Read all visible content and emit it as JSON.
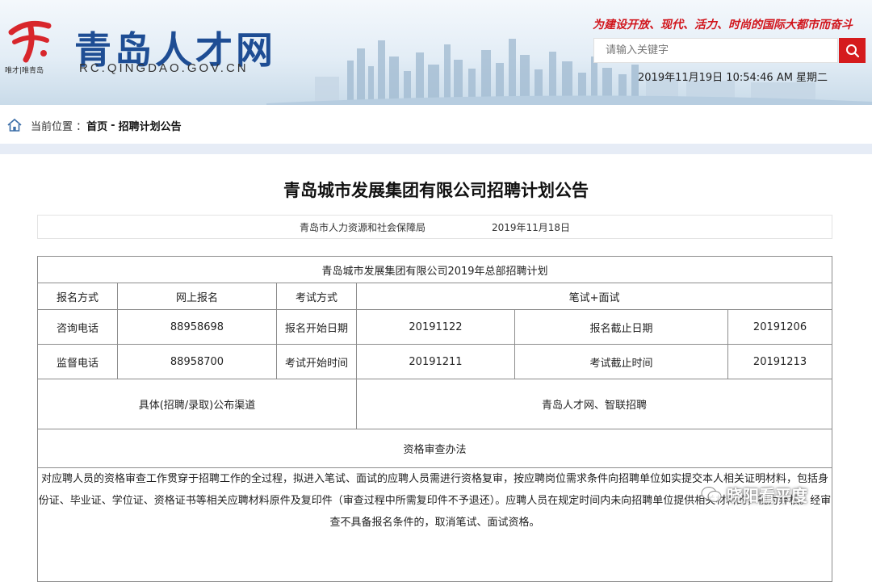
{
  "header": {
    "site_title": "青岛人才网",
    "site_domain": "RC.QINGDAO.GOV.CN",
    "logo_tagline": "唯才|唯青岛",
    "slogan": "为建设开放、现代、活力、时尚的国际大都市而奋斗",
    "search": {
      "placeholder": "请输入关键字"
    },
    "datetime": "2019年11月19日 10:54:46 AM 星期二",
    "accent_color": "#d51b1d",
    "title_color": "#1e4d94"
  },
  "breadcrumb": {
    "label": "当前位置 ：",
    "home": "首页",
    "separator": "-",
    "current": "招聘计划公告"
  },
  "article": {
    "title": "青岛城市发展集团有限公司招聘计划公告",
    "publisher": "青岛市人力资源和社会保障局",
    "date": "2019年11月18日"
  },
  "table": {
    "caption": "青岛城市发展集团有限公司2019年总部招聘计划",
    "signup_method_label": "报名方式",
    "signup_method": "网上报名",
    "exam_method_label": "考试方式",
    "exam_method": "笔试+面试",
    "consult_phone_label": "咨询电话",
    "consult_phone": "88958698",
    "signup_start_label": "报名开始日期",
    "signup_start": "20191122",
    "signup_end_label": "报名截止日期",
    "signup_end": "20191206",
    "supervise_phone_label": "监督电话",
    "supervise_phone": "88958700",
    "exam_start_label": "考试开始时间",
    "exam_start": "20191211",
    "exam_end_label": "考试截止时间",
    "exam_end": "20191213",
    "channel_label": "具体(招聘/录取)公布渠道",
    "channel": "青岛人才网、智联招聘",
    "review_title": "资格审查办法",
    "review_text": "对应聘人员的资格审查工作贯穿于招聘工作的全过程，拟进入笔试、面试的应聘人员需进行资格复审，按应聘岗位需求条件向招聘单位如实提交本人相关证明材料，包括身份证、毕业证、学位证、资格证书等相关应聘材料原件及复印件（审查过程中所需复印件不予退还）。应聘人员在规定时间内未向招聘单位提供相关材料的，视为弃权。经审查不具备报名条件的，取消笔试、面试资格。"
  },
  "watermark": {
    "text": "晓阳看平度"
  }
}
